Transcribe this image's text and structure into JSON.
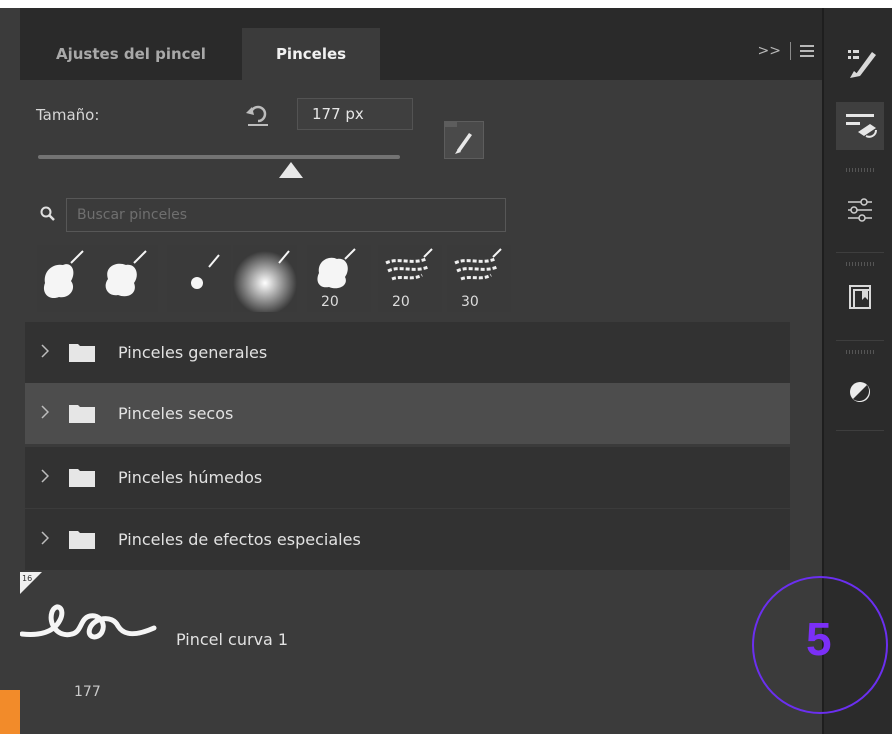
{
  "tabs": [
    {
      "label": "Ajustes del pincel",
      "active": false
    },
    {
      "label": "Pinceles",
      "active": true
    }
  ],
  "tabbar": {
    "collapse_glyph": ">>"
  },
  "size": {
    "label": "Tamaño:",
    "value": "177 px",
    "slider_fraction": 0.7
  },
  "search": {
    "placeholder": "Buscar pinceles"
  },
  "recent_brushes": [
    {
      "kind": "chalk",
      "size_label": ""
    },
    {
      "kind": "chalk",
      "size_label": ""
    },
    {
      "kind": "hard-round",
      "size_label": ""
    },
    {
      "kind": "soft-round",
      "size_label": ""
    },
    {
      "kind": "chalk",
      "size_label": "20"
    },
    {
      "kind": "dry-texture",
      "size_label": "20"
    },
    {
      "kind": "dry-texture",
      "size_label": "30"
    }
  ],
  "groups": [
    {
      "label": "Pinceles generales",
      "selected": false
    },
    {
      "label": "Pinceles secos",
      "selected": true
    },
    {
      "label": "Pinceles húmedos",
      "selected": false
    },
    {
      "label": "Pinceles de efectos especiales",
      "selected": false
    }
  ],
  "brush_item": {
    "name": "Pincel curva 1",
    "size": "177",
    "corner_badge": "16"
  },
  "annotation": {
    "step_number": "5"
  },
  "colors": {
    "panel": "#3b3b3b",
    "accent_circle": "#6b2ff0",
    "orange": "#f28b2a"
  }
}
